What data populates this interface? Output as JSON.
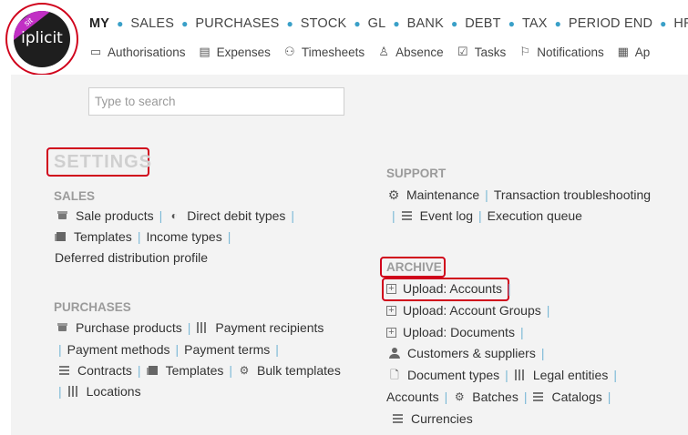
{
  "logo": {
    "text": "iplicit",
    "badge": "sit"
  },
  "nav": {
    "main": [
      "MY",
      "SALES",
      "PURCHASES",
      "STOCK",
      "GL",
      "BANK",
      "DEBT",
      "TAX",
      "PERIOD END",
      "HR"
    ],
    "sub": [
      {
        "label": "Authorisations",
        "icon": "chat-icon"
      },
      {
        "label": "Expenses",
        "icon": "receipt-icon"
      },
      {
        "label": "Timesheets",
        "icon": "timesheet-icon"
      },
      {
        "label": "Absence",
        "icon": "person-icon"
      },
      {
        "label": "Tasks",
        "icon": "checkbox-icon"
      },
      {
        "label": "Notifications",
        "icon": "flag-icon"
      },
      {
        "label": "Ap",
        "icon": "calendar-clock-icon"
      }
    ]
  },
  "search": {
    "placeholder": "Type to search"
  },
  "settings": {
    "title": "SETTINGS",
    "sales": {
      "heading": "SALES",
      "row1": [
        "Sale products",
        "Direct debit types"
      ],
      "row2": [
        "Templates",
        "Income types"
      ],
      "row3": [
        "Deferred distribution profile"
      ]
    },
    "purchases": {
      "heading": "PURCHASES",
      "row1": [
        "Purchase products",
        "Payment recipients"
      ],
      "row2": [
        "Payment methods",
        "Payment terms"
      ],
      "row3": [
        "Contracts",
        "Templates",
        "Bulk templates"
      ],
      "row4": [
        "Locations"
      ]
    }
  },
  "support": {
    "heading": "SUPPORT",
    "row1": [
      "Maintenance",
      "Transaction troubleshooting"
    ],
    "row2": [
      "Event log",
      "Execution queue"
    ]
  },
  "archive": {
    "heading": "ARCHIVE",
    "items": [
      "Upload: Accounts",
      "Upload: Account Groups",
      "Upload: Documents",
      "Customers & suppliers"
    ],
    "row5": [
      "Document types",
      "Legal entities"
    ],
    "row6": [
      "Accounts",
      "Batches",
      "Catalogs"
    ],
    "row7": [
      "Currencies"
    ]
  },
  "colors": {
    "highlight": "#d0021b",
    "nav_dot": "#3aa0c8",
    "separator": "#7ab8d6",
    "badge": "#c12fc4"
  }
}
